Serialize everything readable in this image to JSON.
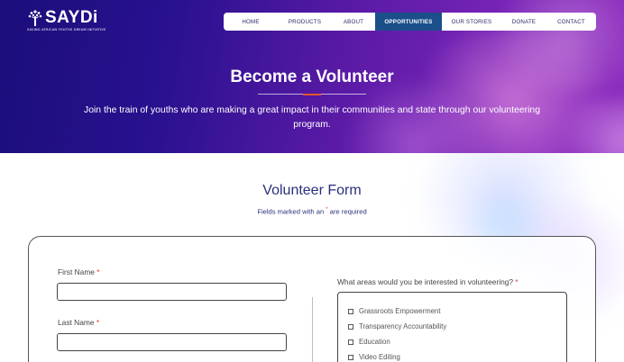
{
  "logo": {
    "name": "SAYDi",
    "tagline": "SAVING AFRICAN YOUTHS DREAM INITIATIVE"
  },
  "nav": [
    {
      "label": "HOME",
      "active": false
    },
    {
      "label": "PRODUCTS",
      "active": false
    },
    {
      "label": "ABOUT",
      "active": false
    },
    {
      "label": "OPPORTUNITIES",
      "active": true
    },
    {
      "label": "OUR STORIES",
      "active": false
    },
    {
      "label": "DONATE",
      "active": false
    },
    {
      "label": "CONTACT",
      "active": false
    }
  ],
  "hero": {
    "title": "Become a Volunteer",
    "subtitle": "Join the train of youths who are making a great impact in their communities and state through our volunteering program."
  },
  "form": {
    "title": "Volunteer Form",
    "note_prefix": "Fields marked with an ",
    "note_star": "*",
    "note_suffix": " are required",
    "required_mark": "*",
    "first_name_label": "First Name",
    "first_name_value": "",
    "last_name_label": "Last Name",
    "last_name_value": "",
    "areas_label": "What areas would you be interested in volunteering?",
    "areas": [
      {
        "label": "Grassroots Empowerment",
        "checked": false
      },
      {
        "label": "Transparency Accountability",
        "checked": false
      },
      {
        "label": "Education",
        "checked": false
      },
      {
        "label": "Video Editing",
        "checked": false
      }
    ]
  },
  "colors": {
    "hero_start": "#1a0e7a",
    "hero_end": "#8e2dbf",
    "nav_active": "#1a4f8a",
    "heading": "#2a2f7a",
    "required": "#e23a3a",
    "accent": "#e2572c"
  }
}
